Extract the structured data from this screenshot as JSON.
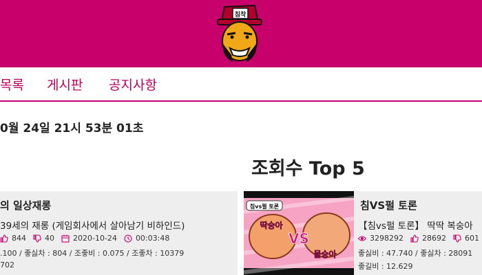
{
  "colors": {
    "brand": "#c8006c",
    "nav_text": "#b8005f",
    "icon": "#c8006c"
  },
  "nav": {
    "items": [
      "목록",
      "게시판",
      "공지사항"
    ]
  },
  "datetime": "0월 24일 21시 53분 01초",
  "section_title": "조회수 Top 5",
  "cards": {
    "left": {
      "title": "의 일상재롱",
      "subtitle": "39세의 재롱 (게임회사에서 살아남기 비하인드)",
      "likes": "844",
      "dislikes": "40",
      "date": "2020-10-24",
      "duration": "00:03:48",
      "stats": ".100 / 좋싫차 : 804 / 조좋비 : 0.075 / 조좋차 : 10379",
      "extra": "702"
    },
    "right": {
      "title": "침VS펄 토론",
      "subtitle": "【침vs펄 토론】 딱딱 복숭아",
      "views": "3298292",
      "likes": "28692",
      "dislikes": "601",
      "stats": "좋싫비 : 47.740 / 좋싫차 : 28091",
      "extra": "좋길비 : 12.629",
      "thumb_badge": "침vs펄 토론",
      "thumb_left": "딱숭아",
      "thumb_vs": "VS",
      "thumb_right": "물숭아"
    }
  }
}
